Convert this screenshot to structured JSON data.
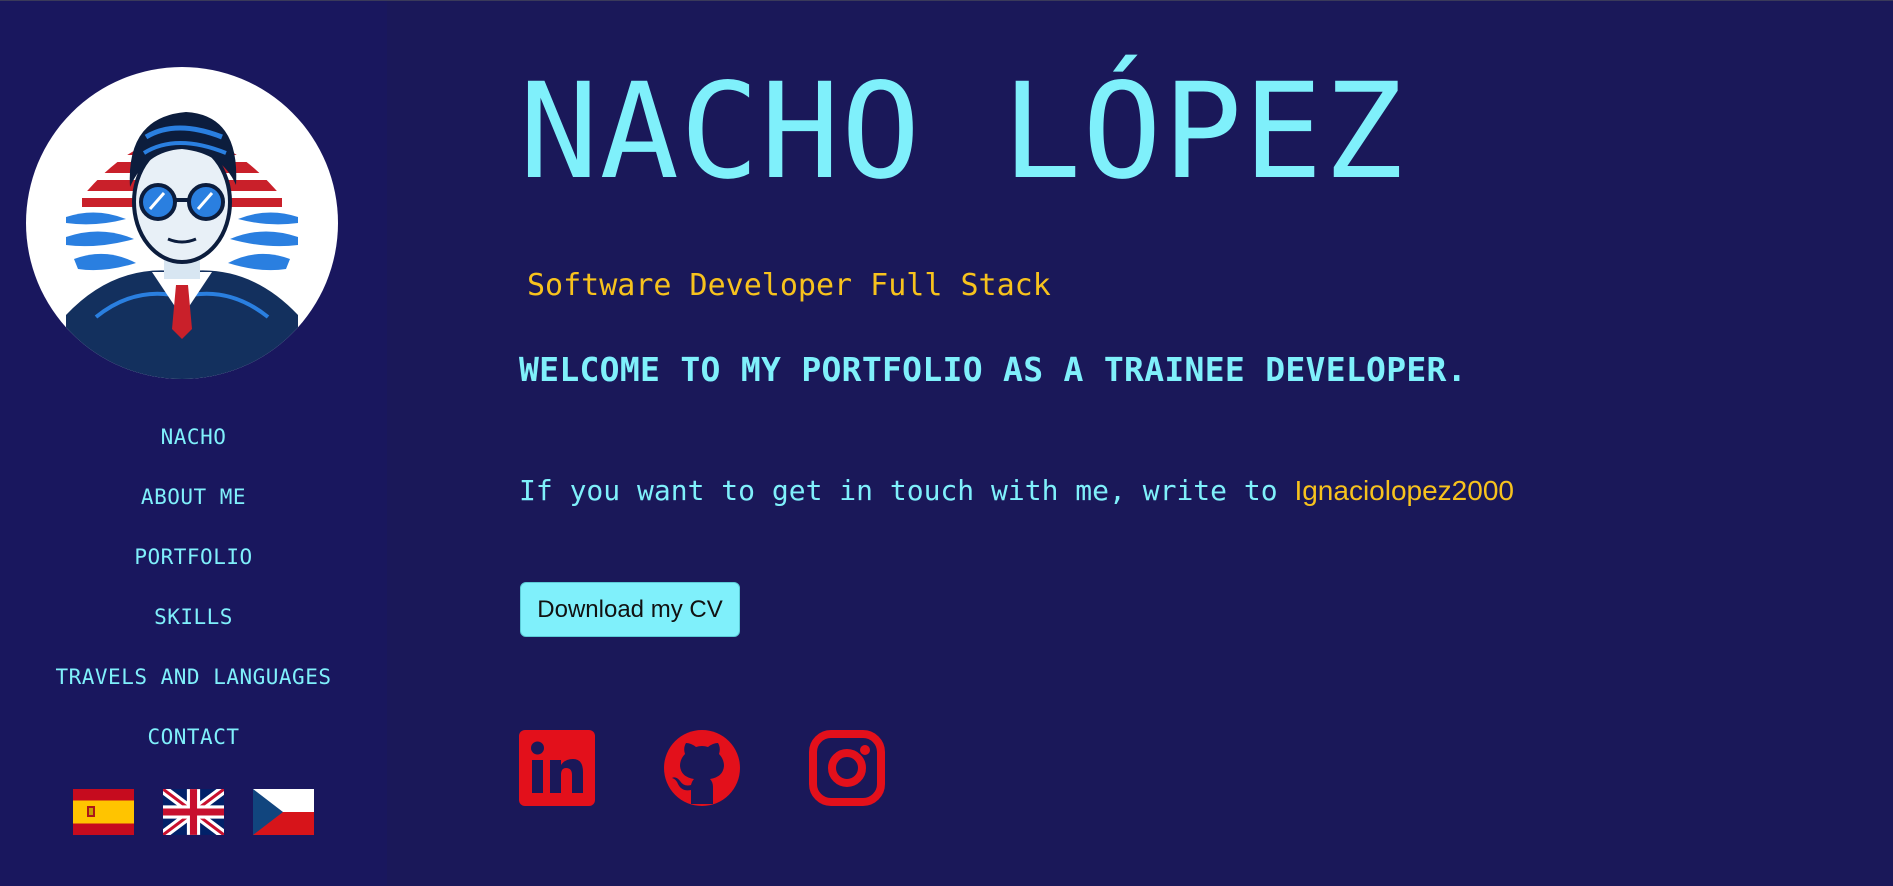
{
  "sidebar": {
    "avatar_alt": "Illustrated portrait with sunglasses",
    "nav": [
      {
        "label": "NACHO"
      },
      {
        "label": "ABOUT ME"
      },
      {
        "label": "PORTFOLIO"
      },
      {
        "label": "SKILLS"
      },
      {
        "label": "TRAVELS AND LANGUAGES"
      },
      {
        "label": "CONTACT"
      }
    ],
    "flags": [
      "spain-flag-icon",
      "uk-flag-icon",
      "czech-flag-icon"
    ]
  },
  "hero": {
    "name": "NACHO LÓPEZ",
    "subtitle": "Software Developer Full Stack",
    "welcome": "WELCOME TO MY PORTFOLIO AS A TRAINEE DEVELOPER.",
    "contact_prefix": "If you want to get in touch with me, write to ",
    "contact_link": "Ignaciolopez2000",
    "cv_button": "Download my CV"
  },
  "social": [
    "linkedin-icon",
    "github-icon",
    "instagram-icon"
  ],
  "colors": {
    "background": "#1a1859",
    "sidebar": "#19175e",
    "accent_cyan": "#7ff0fb",
    "accent_yellow": "#f7c21d",
    "social_red": "#e3101b"
  }
}
